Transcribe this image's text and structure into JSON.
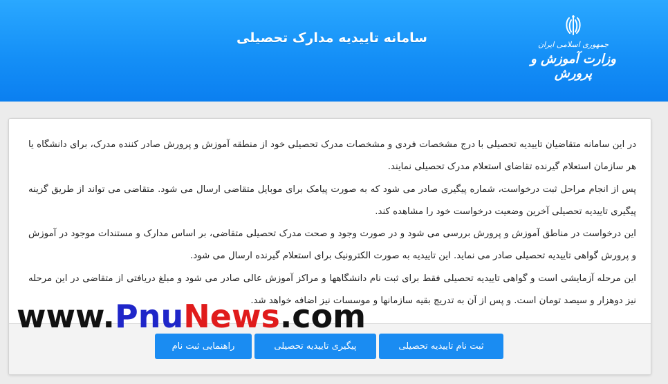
{
  "header": {
    "title": "سامانه تاییدیه مدارک تحصیلی",
    "ministry_line1": "جمهوری اسلامی ایران",
    "ministry_line2": "وزارت آموزش و پرورش",
    "emblem_icon": "iran-emblem-icon",
    "background_color": "#1590f7"
  },
  "intro": {
    "paragraph1": "در این سامانه متقاضیان تاییدیه تحصیلی با درج مشخصات فردی و مشخصات مدرک تحصیلی خود از منطقه آموزش و پرورش صادر کننده مدرک، برای دانشگاه یا هر سازمان استعلام گیرنده تقاضای استعلام مدرک تحصیلی نمایند.",
    "paragraph2": "پس از انجام مراحل ثبت درخواست، شماره پیگیری صادر می شود که به صورت پیامک برای موبایل متقاضی ارسال می شود. متقاضی می تواند از طریق گزینه پیگیری تاییدیه تحصیلی آخرین وضعیت درخواست خود را مشاهده کند.",
    "paragraph3": "این درخواست در مناطق آموزش و پرورش بررسی می شود و در صورت وجود و صحت مدرک تحصیلی متقاضی، بر اساس مدارک و مستندات موجود در آموزش و پرورش گواهی تاییدیه تحصیلی صادر می نماید. این تاییدیه به صورت الکترونیک برای استعلام گیرنده ارسال می شود.",
    "paragraph4": "این مرحله آزمایشی است و گواهی تاییدیه تحصیلی فقط برای ثبت نام دانشگاهها و مراکز آموزش عالی صادر می شود و مبلغ دریافتی از متقاضی در این مرحله نیز دوهزار و سیصد تومان است. و پس از آن به تدریج بقیه سازمانها و موسسات نیز اضافه خواهد شد."
  },
  "buttons": {
    "register": "ثبت نام تاییدیه تحصیلی",
    "track": "پیگیری تاییدیه تحصیلی",
    "guide": "راهنمایی ثبت نام",
    "color": "#1a8cf2"
  },
  "watermark": {
    "prefix": "www.",
    "brand_blue": "Pnu",
    "brand_red": "News",
    "suffix": ".com"
  }
}
